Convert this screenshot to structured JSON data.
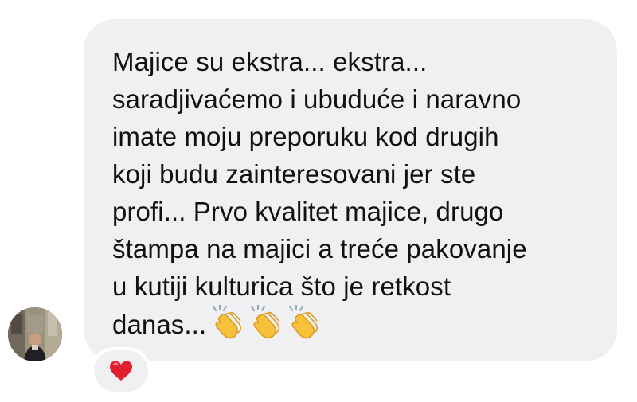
{
  "message": {
    "lines": [
      "Majice su ekstra... ekstra...",
      "saradjivaćemo i ubuduće i naravno",
      "imate moju preporuku kod drugih",
      "koji budu zainteresovani jer ste",
      "profi... Prvo kvalitet majice, drugo",
      "štampa na majici a treće pakovanje",
      "u kutiji kulturica što je retkost",
      "danas..."
    ],
    "trailing_emojis": [
      "clapping-hands",
      "clapping-hands",
      "clapping-hands"
    ]
  },
  "reaction": {
    "emoji": "red-heart"
  },
  "colors": {
    "bubble_bg": "#f0f0f2",
    "text": "#111111",
    "heart": "#e0202c",
    "clap": "#f7c23a"
  }
}
